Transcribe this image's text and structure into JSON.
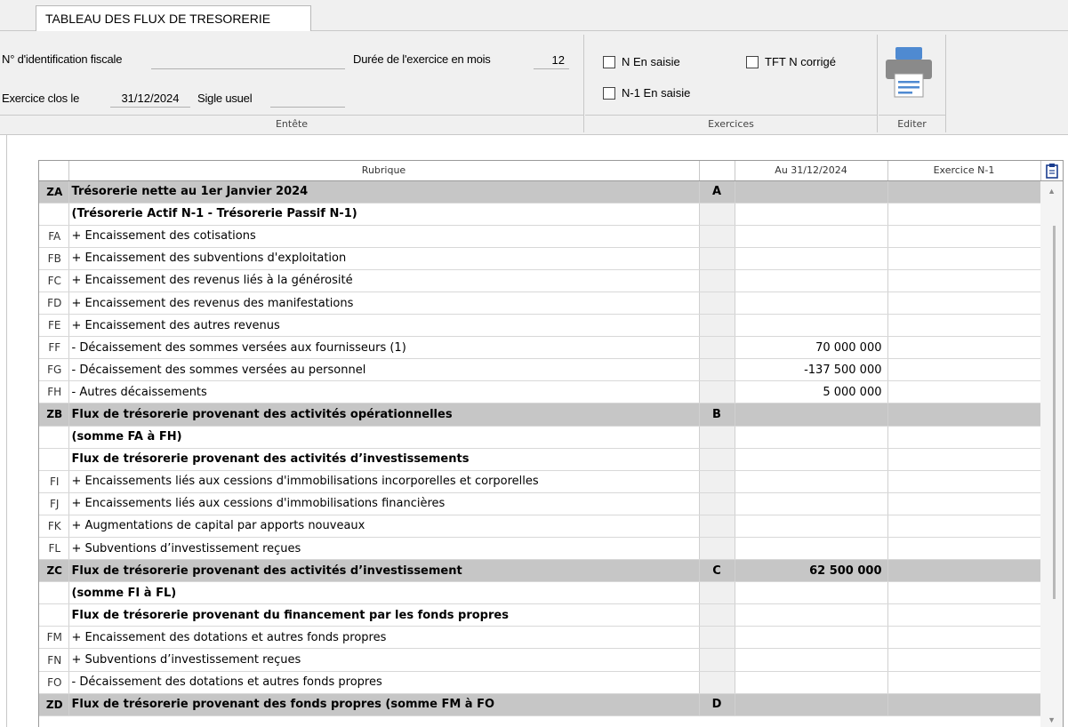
{
  "tab": {
    "title": "TABLEAU DES FLUX DE TRESORERIE"
  },
  "header": {
    "id_fiscal_label": "N° d'identification fiscale",
    "id_fiscal_value": "",
    "duree_label": "Durée de l'exercice en mois",
    "duree_value": "12",
    "exercice_label": "Exercice clos le",
    "exercice_value": "31/12/2024",
    "sigle_label": "Sigle usuel",
    "sigle_value": "",
    "entete_caption": "Entête"
  },
  "exercices": {
    "n_saisie": "N En saisie",
    "tft_corrige": "TFT N corrigé",
    "n1_saisie": "N-1 En saisie",
    "caption": "Exercices"
  },
  "editer": {
    "caption": "Editer",
    "icon": "printer-icon"
  },
  "grid": {
    "columns": {
      "rubrique": "Rubrique",
      "ref": "",
      "n": "Au 31/12/2024",
      "n1": "Exercice N-1"
    },
    "rows": [
      {
        "code": "ZA",
        "label": "Trésorerie nette au 1er Janvier 2024",
        "ref": "A",
        "n": "",
        "n1": "",
        "type": "total"
      },
      {
        "code": "",
        "label": "(Trésorerie Actif N-1 - Trésorerie Passif N-1)",
        "ref": "",
        "n": "",
        "n1": "",
        "type": "sub"
      },
      {
        "code": "FA",
        "label": "+ Encaissement des cotisations",
        "ref": "",
        "n": "",
        "n1": "",
        "type": ""
      },
      {
        "code": "FB",
        "label": "+ Encaissement des subventions d'exploitation",
        "ref": "",
        "n": "",
        "n1": "",
        "type": ""
      },
      {
        "code": "FC",
        "label": "+ Encaissement des revenus liés à la générosité",
        "ref": "",
        "n": "",
        "n1": "",
        "type": ""
      },
      {
        "code": "FD",
        "label": "+ Encaissement des revenus des manifestations",
        "ref": "",
        "n": "",
        "n1": "",
        "type": ""
      },
      {
        "code": "FE",
        "label": "+ Encaissement des autres revenus",
        "ref": "",
        "n": "",
        "n1": "",
        "type": ""
      },
      {
        "code": "FF",
        "label": "- Décaissement des sommes versées aux fournisseurs (1)",
        "ref": "",
        "n": "70 000 000",
        "n1": "",
        "type": ""
      },
      {
        "code": "FG",
        "label": "- Décaissement des sommes versées au personnel",
        "ref": "",
        "n": "-137 500 000",
        "n1": "",
        "type": ""
      },
      {
        "code": "FH",
        "label": "- Autres décaissements",
        "ref": "",
        "n": "5 000 000",
        "n1": "",
        "type": ""
      },
      {
        "code": "ZB",
        "label": "Flux de trésorerie provenant des activités opérationnelles",
        "ref": "B",
        "n": "",
        "n1": "",
        "type": "total"
      },
      {
        "code": "",
        "label": "(somme FA à FH)",
        "ref": "",
        "n": "",
        "n1": "",
        "type": "sub"
      },
      {
        "code": "",
        "label": "Flux de trésorerie provenant des activités d’investissements",
        "ref": "",
        "n": "",
        "n1": "",
        "type": "sub"
      },
      {
        "code": "FI",
        "label": "+ Encaissements liés aux cessions d'immobilisations incorporelles et corporelles",
        "ref": "",
        "n": "",
        "n1": "",
        "type": ""
      },
      {
        "code": "FJ",
        "label": "+ Encaissements liés aux cessions d'immobilisations financières",
        "ref": "",
        "n": "",
        "n1": "",
        "type": ""
      },
      {
        "code": "FK",
        "label": "+ Augmentations de capital par apports nouveaux",
        "ref": "",
        "n": "",
        "n1": "",
        "type": ""
      },
      {
        "code": "FL",
        "label": "+ Subventions d’investissement reçues",
        "ref": "",
        "n": "",
        "n1": "",
        "type": ""
      },
      {
        "code": "ZC",
        "label": "Flux de trésorerie provenant des activités d’investissement",
        "ref": "C",
        "n": "62 500 000",
        "n1": "",
        "type": "total"
      },
      {
        "code": "",
        "label": "(somme FI à FL)",
        "ref": "",
        "n": "",
        "n1": "",
        "type": "sub"
      },
      {
        "code": "",
        "label": "Flux de trésorerie provenant du financement par les fonds propres",
        "ref": "",
        "n": "",
        "n1": "",
        "type": "sub"
      },
      {
        "code": "FM",
        "label": "+ Encaissement des dotations et autres fonds propres",
        "ref": "",
        "n": "",
        "n1": "",
        "type": ""
      },
      {
        "code": "FN",
        "label": "+ Subventions d’investissement reçues",
        "ref": "",
        "n": "",
        "n1": "",
        "type": ""
      },
      {
        "code": "FO",
        "label": "- Décaissement des dotations et autres fonds propres",
        "ref": "",
        "n": "",
        "n1": "",
        "type": ""
      },
      {
        "code": "ZD",
        "label": "Flux de trésorerie provenant des fonds propres (somme FM à FO",
        "ref": "D",
        "n": "",
        "n1": "",
        "type": "total"
      }
    ]
  }
}
